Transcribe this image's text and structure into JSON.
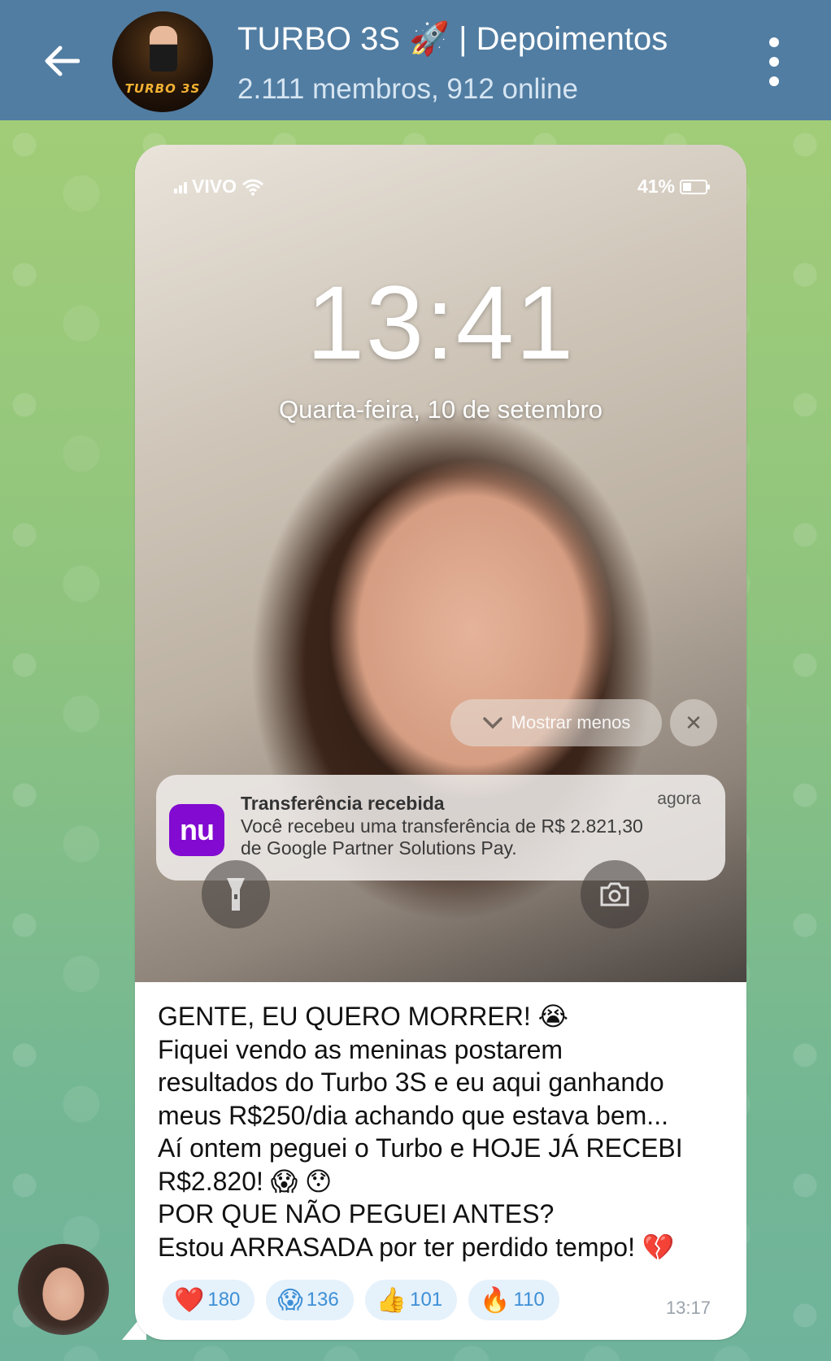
{
  "header": {
    "title": "TURBO 3S 🚀 | Depoimentos",
    "subtitle": "2.111 membros, 912 online",
    "avatar_logo_text": "TURBO 3S",
    "colors": {
      "bar": "#517da2"
    }
  },
  "lockscreen": {
    "carrier": "VIVO",
    "battery": "41%",
    "time": "13:41",
    "date": "Quarta-feira, 10 de setembro",
    "show_less_label": "Mostrar menos",
    "notification": {
      "app_icon_text": "nu",
      "title": "Transferência recebida",
      "time": "agora",
      "body_line1": "Você recebeu uma transferência de R$ 2.821,30",
      "body_line2": "de Google Partner Solutions Pay.",
      "icon_color": "#820ad1"
    }
  },
  "message": {
    "lines": [
      "GENTE, EU QUERO MORRER! 😭",
      "Fiquei vendo as meninas postarem",
      "resultados do Turbo 3S e eu aqui ganhando",
      "meus R$250/dia achando que estava bem...",
      "Aí ontem peguei o Turbo e HOJE JÁ RECEBI",
      "R$2.820! 😱 😯",
      "POR QUE NÃO PEGUEI ANTES?",
      "Estou ARRASADA por ter perdido tempo! 💔"
    ],
    "reactions": [
      {
        "emoji": "❤️",
        "count": "180"
      },
      {
        "emoji": "😱",
        "count": "136"
      },
      {
        "emoji": "👍",
        "count": "101"
      },
      {
        "emoji": "🔥",
        "count": "110"
      }
    ],
    "time": "13:17"
  }
}
